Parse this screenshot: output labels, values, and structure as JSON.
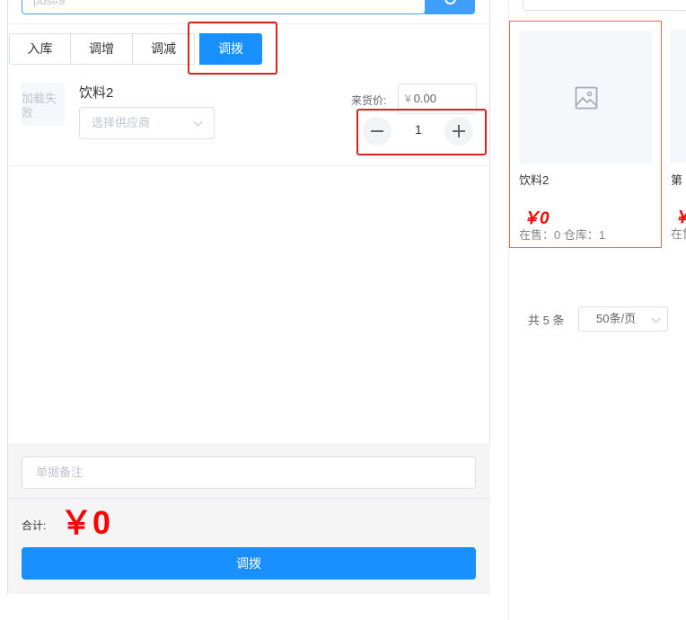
{
  "search": {
    "placeholder_partial": "pos#9"
  },
  "tabs": [
    {
      "label": "入库"
    },
    {
      "label": "调增"
    },
    {
      "label": "调减"
    },
    {
      "label": "调拨"
    }
  ],
  "line_item": {
    "image_fail_text": "加载失败",
    "name": "饮料2",
    "supplier_placeholder": "选择供应商",
    "price_label": "来货价:",
    "currency": "¥",
    "price_value": "0.00",
    "quantity": "1"
  },
  "footer": {
    "remark_placeholder": "单据备注",
    "total_label": "合计:",
    "total_value": "￥0",
    "submit_label": "调拨"
  },
  "products": [
    {
      "name": "饮料2",
      "price": "￥0",
      "stock": "在售：0 仓库：1"
    },
    {
      "name": "第",
      "price": "￥",
      "stock": "在售"
    }
  ],
  "pagination": {
    "total": "共 5 条",
    "page_size": "50条/页"
  },
  "colors": {
    "primary": "#1890ff",
    "price_red": "#ff0000",
    "highlight_red": "#e02020",
    "card_border": "#e56b45"
  }
}
